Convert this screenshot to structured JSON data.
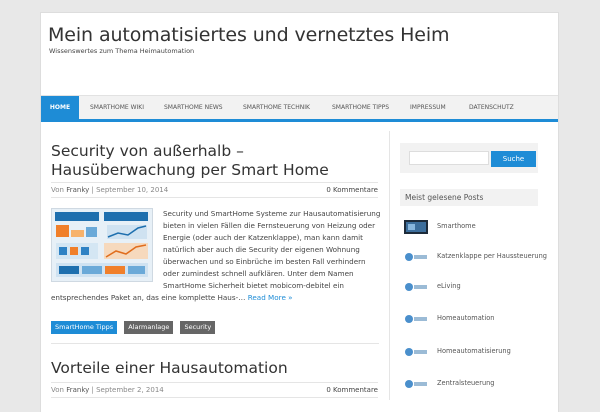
{
  "header": {
    "site_title": "Mein automatisiertes und vernetztes Heim",
    "tagline": "Wissenswertes zum Thema Heimautomation"
  },
  "nav": {
    "items": [
      {
        "label": "HOME",
        "active": true
      },
      {
        "label": "SMARTHOME WIKI"
      },
      {
        "label": "SMARTHOME NEWS"
      },
      {
        "label": "SMARTHOME TECHNIK"
      },
      {
        "label": "SMARTHOME TIPPS"
      },
      {
        "label": "IMPRESSUM"
      },
      {
        "label": "DATENSCHUTZ"
      }
    ]
  },
  "posts": [
    {
      "title": "Security von außerhalb – Hausüberwachung per Smart Home",
      "by": "Von",
      "author": "Franky",
      "sep": "|",
      "date": "September 10, 2014",
      "comments": "0 Kommentare",
      "excerpt": "Security und SmartHome Systeme zur Hausautomatisierung bieten in vielen Fällen die Fernsteuerung von Heizung oder Energie (oder auch der Katzenklappe), man kann damit natürlich aber auch die Security der eigenen Wohnung überwachen und so Einbrüche im besten Fall verhindern oder zumindest schnell aufklären. Unter dem Namen SmartHome Sicherheit bietet mobicom-debitel ein entsprechendes Paket an, das eine komplette Haus-…",
      "read_more": "Read More »",
      "tags": [
        "SmartHome Tipps",
        "Alarmanlage",
        "Security"
      ]
    },
    {
      "title": "Vorteile einer Hausautomation",
      "by": "Von",
      "author": "Franky",
      "sep": "|",
      "date": "September 2, 2014",
      "comments": "0 Kommentare"
    }
  ],
  "sidebar": {
    "search_button": "Suche",
    "search_placeholder": "",
    "popular_title": "Meist gelesene Posts",
    "popular": [
      "Smarthome",
      "Katzenklappe per Haussteuerung",
      "eLiving",
      "Homeautomation",
      "Homeautomatisierung",
      "Zentralsteuerung"
    ]
  },
  "colors": {
    "accent": "#1e8cd6",
    "tag_grey": "#666666"
  }
}
